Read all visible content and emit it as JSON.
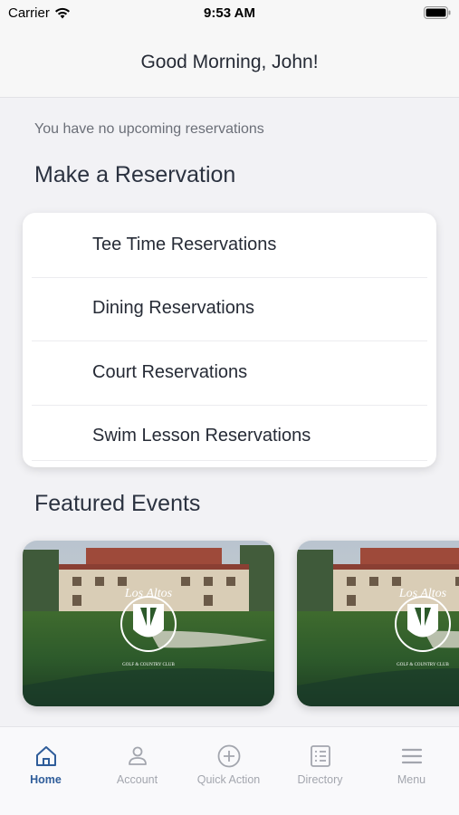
{
  "status_bar": {
    "carrier": "Carrier",
    "time": "9:53 AM"
  },
  "header": {
    "greeting": "Good Morning, John!"
  },
  "reservations_notice": "You have no upcoming reservations",
  "make_reservation": {
    "title": "Make a Reservation",
    "items": [
      {
        "label": "Tee Time Reservations"
      },
      {
        "label": "Dining Reservations"
      },
      {
        "label": "Court Reservations"
      },
      {
        "label": "Swim Lesson Reservations"
      }
    ]
  },
  "featured_events": {
    "title": "Featured Events",
    "cards": [
      {
        "logo_script": "Los Altos",
        "logo_caption": "GOLF & COUNTRY CLUB"
      },
      {
        "logo_script": "Los Altos",
        "logo_caption": "GOLF & COUNTRY CLUB"
      }
    ]
  },
  "tab_bar": {
    "tabs": [
      {
        "label": "Home",
        "icon": "home-icon",
        "active": true
      },
      {
        "label": "Account",
        "icon": "person-icon",
        "active": false
      },
      {
        "label": "Quick Action",
        "icon": "plus-circle-icon",
        "active": false
      },
      {
        "label": "Directory",
        "icon": "directory-icon",
        "active": false
      },
      {
        "label": "Menu",
        "icon": "menu-icon",
        "active": false
      }
    ]
  },
  "colors": {
    "accent": "#2f5d9a",
    "inactive_tab": "#a3a6ae",
    "background": "#f2f2f5"
  }
}
